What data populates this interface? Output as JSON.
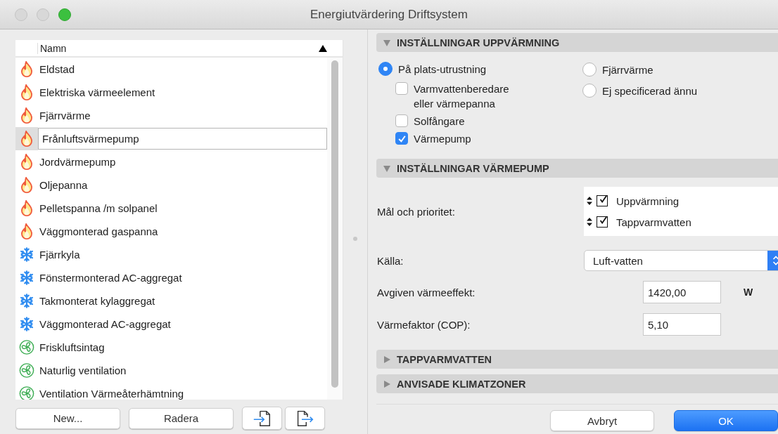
{
  "window": {
    "title": "Energiutvärdering Driftsystem"
  },
  "list": {
    "column": "Namn",
    "sort_ascending": true,
    "items": [
      {
        "label": "Eldstad",
        "kind": "flame",
        "selected": false
      },
      {
        "label": "Elektriska värmeelement",
        "kind": "flame",
        "selected": false
      },
      {
        "label": "Fjärrvärme",
        "kind": "flame",
        "selected": false
      },
      {
        "label": "Frånluftsvärmepump",
        "kind": "flame",
        "selected": true
      },
      {
        "label": "Jordvärmepump",
        "kind": "flame",
        "selected": false
      },
      {
        "label": "Oljepanna",
        "kind": "flame",
        "selected": false
      },
      {
        "label": "Pelletspanna /m solpanel",
        "kind": "flame",
        "selected": false
      },
      {
        "label": "Väggmonterad gaspanna",
        "kind": "flame",
        "selected": false
      },
      {
        "label": "Fjärrkyla",
        "kind": "snowflake",
        "selected": false
      },
      {
        "label": "Fönstermonterad AC-aggregat",
        "kind": "snowflake",
        "selected": false
      },
      {
        "label": "Takmonterat kylaggregat",
        "kind": "snowflake",
        "selected": false
      },
      {
        "label": "Väggmonterad AC-aggregat",
        "kind": "snowflake",
        "selected": false
      },
      {
        "label": "Friskluftsintag",
        "kind": "fan",
        "selected": false
      },
      {
        "label": "Naturlig ventilation",
        "kind": "fan",
        "selected": false
      },
      {
        "label": "Ventilation Värmeåterhämtning",
        "kind": "fan",
        "selected": false
      }
    ]
  },
  "list_buttons": [
    {
      "kind": "text",
      "label": "New..."
    },
    {
      "kind": "text",
      "label": "Radera"
    },
    {
      "kind": "import"
    },
    {
      "kind": "export"
    }
  ],
  "sections": [
    {
      "kind": "heating",
      "title": "INSTÄLLNINGAR UPPVÄRMNING",
      "expanded": true,
      "radios": [
        {
          "label": "På plats-utrustning",
          "selected": true,
          "options": [
            {
              "label": "Varmvattenberedare eller värmepanna",
              "checked": false
            },
            {
              "label": "Solfångare",
              "checked": false
            },
            {
              "label": "Värmepump",
              "checked": true
            }
          ]
        },
        {
          "label": "Fjärrvärme",
          "selected": false
        },
        {
          "label": "Ej specificerad ännu",
          "selected": false
        }
      ]
    },
    {
      "kind": "heatpump",
      "title": "INSTÄLLNINGAR VÄRMEPUMP",
      "expanded": true,
      "goals": {
        "label": "Mål och prioritet:",
        "items": [
          {
            "label": "Uppvärmning",
            "checked": true
          },
          {
            "label": "Tappvarmvatten",
            "checked": true
          }
        ]
      },
      "source": {
        "label": "Källa:",
        "value": "Luft-vatten"
      },
      "fields": [
        {
          "label": "Avgiven värmeeffekt:",
          "value": "1420,00",
          "unit": "W"
        },
        {
          "label": "Värmefaktor (COP):",
          "value": "5,10"
        }
      ]
    },
    {
      "kind": "plain",
      "title": "TAPPVARMVATTEN",
      "expanded": false
    },
    {
      "kind": "plain",
      "title": "ANVISADE KLIMATZONER",
      "expanded": false
    }
  ],
  "footer": {
    "cancel": "Avbryt",
    "ok": "OK"
  }
}
